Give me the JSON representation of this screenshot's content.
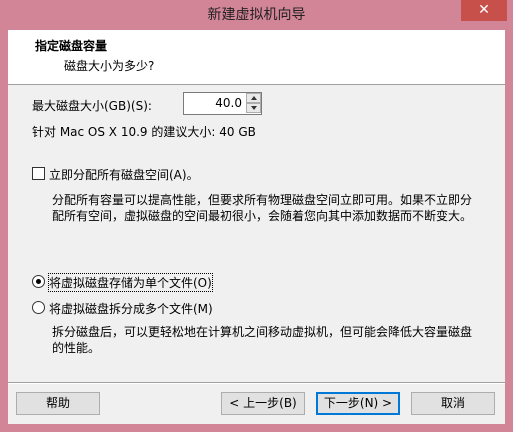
{
  "window": {
    "title": "新建虚拟机向导",
    "close_glyph": "✕"
  },
  "header": {
    "title": "指定磁盘容量",
    "subtitle": "磁盘大小为多少?"
  },
  "disk_size": {
    "label": "最大磁盘大小(GB)(S):",
    "value": "40.0",
    "recommend_text": "针对 Mac OS X 10.9 的建议大小: 40 GB"
  },
  "allocate": {
    "label": "立即分配所有磁盘空间(A)。",
    "checked": false,
    "description": "分配所有容量可以提高性能，但要求所有物理磁盘空间立即可用。如果不立即分配所有空间，虚拟磁盘的空间最初很小，会随着您向其中添加数据而不断变大。"
  },
  "storage_options": [
    {
      "label": "将虚拟磁盘存储为单个文件(O)",
      "selected": true
    },
    {
      "label": "将虚拟磁盘拆分成多个文件(M)",
      "selected": false,
      "description": "拆分磁盘后，可以更轻松地在计算机之间移动虚拟机，但可能会降低大容量磁盘的性能。"
    }
  ],
  "buttons": {
    "help": "帮助",
    "prev": "< 上一步(B)",
    "next": "下一步(N) >",
    "cancel": "取消"
  }
}
